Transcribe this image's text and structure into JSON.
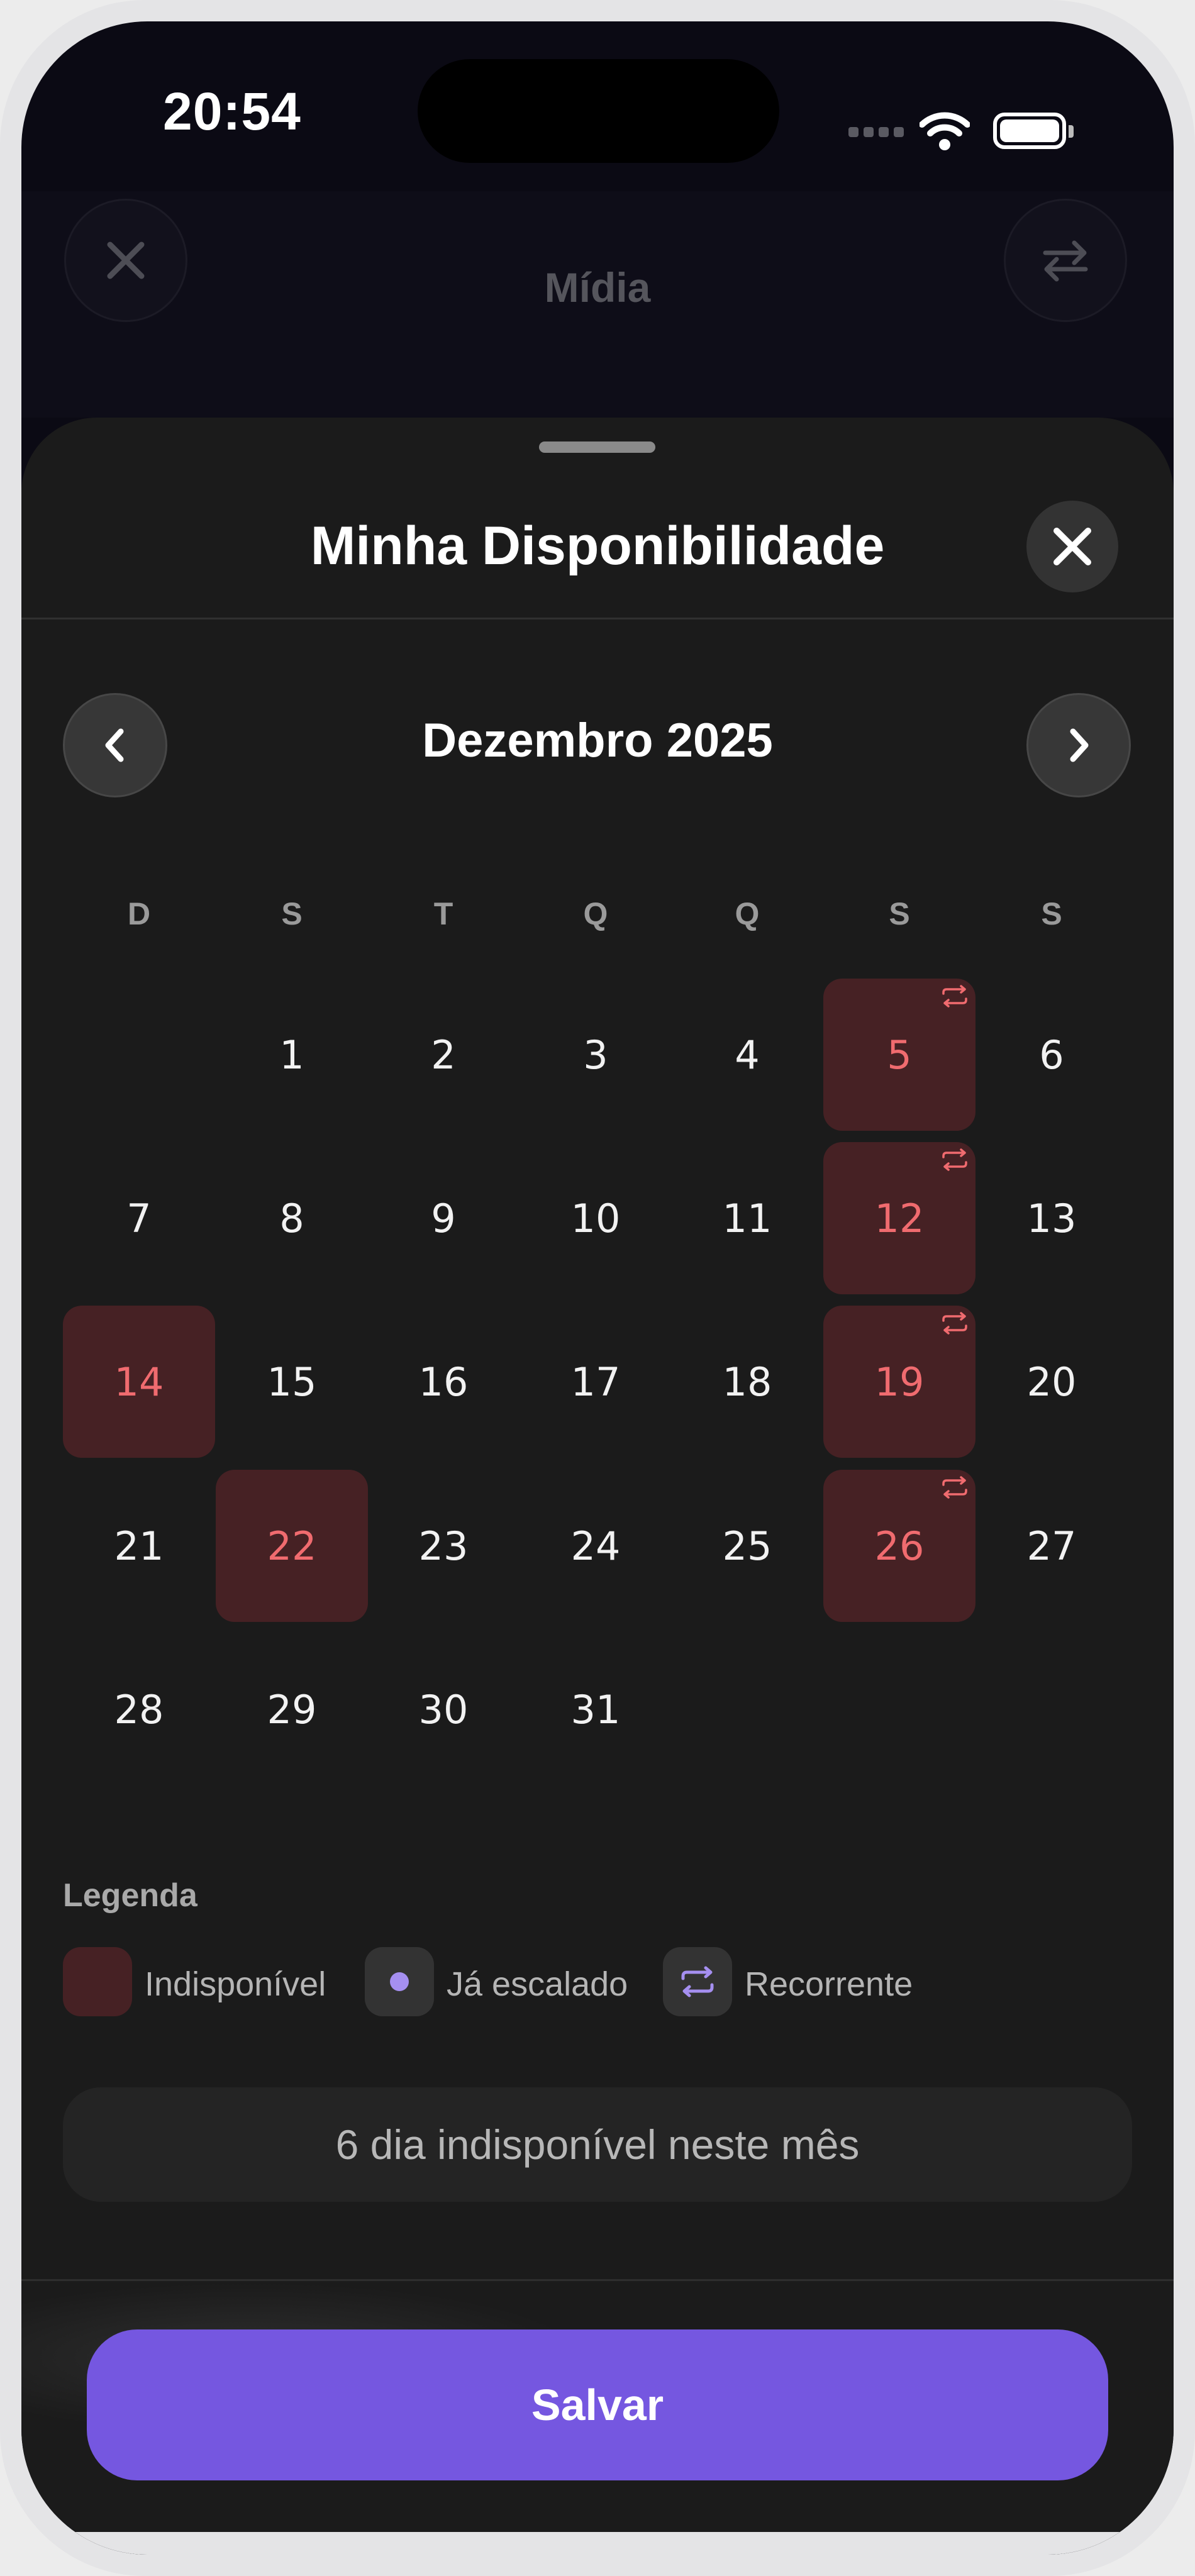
{
  "status_bar": {
    "time": "20:54"
  },
  "background_header": {
    "title": "Mídia"
  },
  "sheet": {
    "title": "Minha Disponibilidade",
    "month_label": "Dezembro 2025",
    "weekdays": [
      "D",
      "S",
      "T",
      "Q",
      "Q",
      "S",
      "S"
    ],
    "first_weekday_index": 1,
    "days_in_month": 31,
    "unavailable_days": [
      5,
      12,
      14,
      19,
      22,
      26
    ],
    "recurring_days": [
      5,
      12,
      19,
      26
    ],
    "legend": {
      "title": "Legenda",
      "unavailable": "Indisponível",
      "scheduled": "Já escalado",
      "recurring": "Recorrente"
    },
    "summary": "6 dia indisponível neste mês",
    "save_label": "Salvar"
  },
  "colors": {
    "accent": "#7557e0",
    "unavailable_bg": "#462124",
    "unavailable_text": "#f06b6f",
    "scheduled_dot": "#a58ff0",
    "recurring_icon": "#a58ff0"
  },
  "icons": {
    "close": "close-icon",
    "prev": "chevron-left-icon",
    "next": "chevron-right-icon",
    "swap": "swap-arrows-icon",
    "recurring": "repeat-icon"
  }
}
